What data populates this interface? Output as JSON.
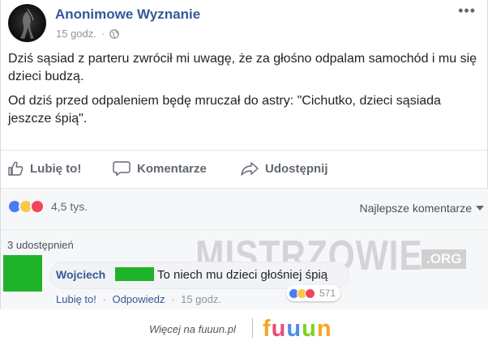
{
  "post": {
    "page_name": "Anonimowe Wyznanie",
    "time": "15 godz.",
    "separator": "·",
    "more_icon": "more-dots-icon",
    "privacy_icon": "globe-icon",
    "paragraphs": [
      "Dziś sąsiad z parteru zwrócił mi uwagę, że za głośno odpalam samochód i mu się dzieci budzą.",
      "Od dziś przed odpaleniem będę mruczał do astry: \"Cichutko, dzieci sąsiada jeszcze śpią\"."
    ]
  },
  "actions": {
    "like": "Lubię to!",
    "comment": "Komentarze",
    "share": "Udostępnij"
  },
  "summary": {
    "reactions_count": "4,5 tys.",
    "reaction_icons": [
      "like-reaction-icon",
      "haha-reaction-icon",
      "love-reaction-icon"
    ],
    "sort_label": "Najlepsze komentarze",
    "shares": "3 udostępnień"
  },
  "watermark": {
    "text": "MISTRZOWIE",
    "suffix": ".ORG"
  },
  "comment": {
    "author": "Wojciech",
    "text": "To niech mu dzieci głośniej śpią",
    "reactions_count": "571",
    "like": "Lubię to!",
    "reply": "Odpowiedz",
    "time": "15 godz.",
    "separator": "·"
  },
  "footer": {
    "text": "Więcej na fuuun.pl",
    "logo": [
      "f",
      "u",
      "u",
      "u",
      "n"
    ],
    "logo_colors": [
      "#f5a623",
      "#e94e77",
      "#4a90e2",
      "#7ed321",
      "#f5a623"
    ]
  },
  "colors": {
    "link_blue": "#365899",
    "censor_green": "#1fb32a",
    "like_blue": "#4a7bf0",
    "haha_yellow": "#f7c948",
    "love_red": "#f0455a"
  }
}
